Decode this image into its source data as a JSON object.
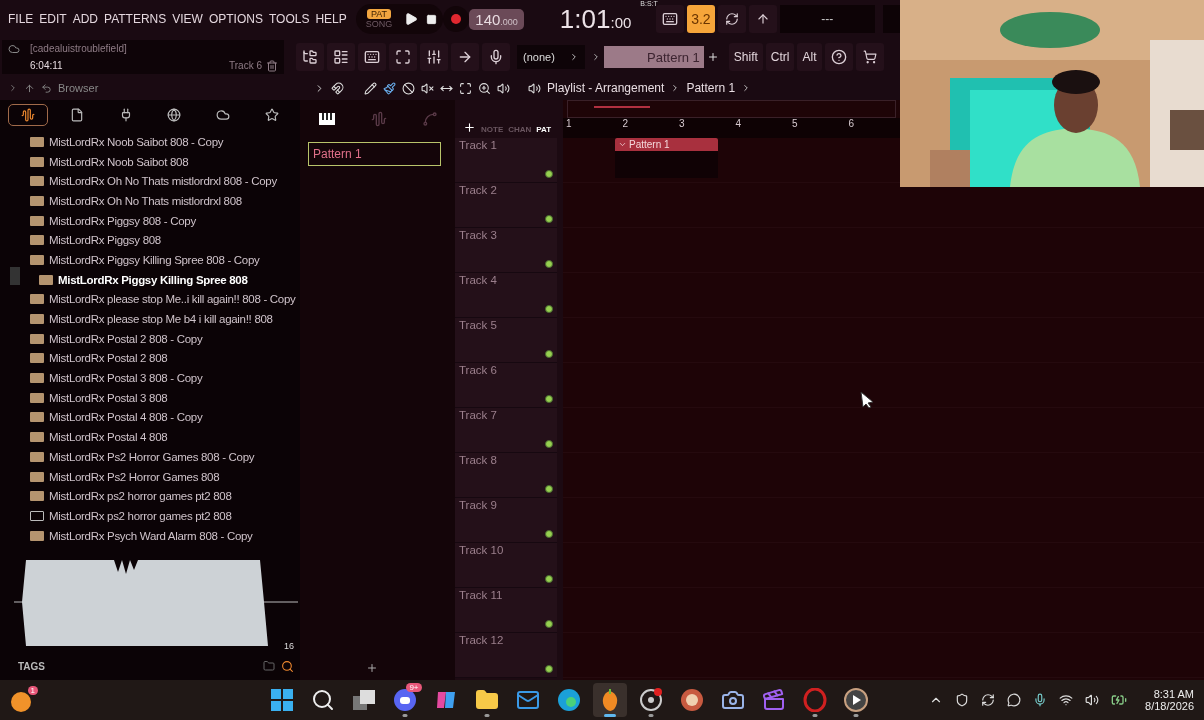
{
  "menu": [
    "FILE",
    "EDIT",
    "ADD",
    "PATTERNS",
    "VIEW",
    "OPTIONS",
    "TOOLS",
    "HELP"
  ],
  "transport": {
    "modes": [
      {
        "label": "PAT",
        "selected": true
      },
      {
        "label": "SONG",
        "selected": false
      }
    ],
    "tempo": "140",
    "tempo_fraction": ".000"
  },
  "time": {
    "main": "1:01",
    "sub": ":00",
    "format": "B:S:T"
  },
  "displays": {
    "value": "3.2",
    "center": "---"
  },
  "hint": {
    "user": "[cadealuistroublefield]",
    "elapsed": "6:04:11",
    "track": "Track 6"
  },
  "pattern_selector": {
    "channel": "(none)",
    "pattern": "Pattern 1"
  },
  "modifier_keys": [
    "Shift",
    "Ctrl",
    "Alt"
  ],
  "browser": {
    "title": "Browser",
    "tabs": [
      {
        "kind": "all",
        "selected": true
      },
      {
        "kind": "files",
        "selected": false
      },
      {
        "kind": "plugins",
        "selected": false
      },
      {
        "kind": "web",
        "selected": false
      },
      {
        "kind": "cloud",
        "selected": false
      },
      {
        "kind": "favorites",
        "selected": false
      }
    ],
    "files": [
      {
        "name": "MistLordRx Noob Saibot 808 - Copy",
        "kind": "mp3",
        "selected": false
      },
      {
        "name": "MistLordRx Noob Saibot 808",
        "kind": "mp3",
        "selected": false
      },
      {
        "name": "MistLordRx Oh No Thats mistlordrxl 808 - Copy",
        "kind": "mp3",
        "selected": false
      },
      {
        "name": "MistLordRx Oh No Thats mistlordrxl 808",
        "kind": "mp3",
        "selected": false
      },
      {
        "name": "MistLordRx Piggsy 808 - Copy",
        "kind": "mp3",
        "selected": false
      },
      {
        "name": "MistLordRx Piggsy 808",
        "kind": "mp3",
        "selected": false
      },
      {
        "name": "MistLordRx Piggsy Killing Spree 808 - Copy",
        "kind": "mp3",
        "selected": false
      },
      {
        "name": "MistLordRx Piggsy Killing Spree 808",
        "kind": "mp3",
        "selected": true
      },
      {
        "name": "MistLordRx please stop Me..i kill again!! 808 - Copy",
        "kind": "mp3",
        "selected": false
      },
      {
        "name": "MistLordRx please stop Me b4 i kill again!! 808",
        "kind": "mp3",
        "selected": false
      },
      {
        "name": "MistLordRx Postal 2 808 - Copy",
        "kind": "mp3",
        "selected": false
      },
      {
        "name": "MistLordRx Postal 2 808",
        "kind": "mp3",
        "selected": false
      },
      {
        "name": "MistLordRx Postal 3 808 - Copy",
        "kind": "mp3",
        "selected": false
      },
      {
        "name": "MistLordRx Postal 3 808",
        "kind": "mp3",
        "selected": false
      },
      {
        "name": "MistLordRx Postal 4 808 - Copy",
        "kind": "mp3",
        "selected": false
      },
      {
        "name": "MistLordRx Postal 4 808",
        "kind": "mp3",
        "selected": false
      },
      {
        "name": "MistLordRx Ps2 Horror Games 808 - Copy",
        "kind": "mp3",
        "selected": false
      },
      {
        "name": "MistLordRx Ps2 Horror Games 808",
        "kind": "mp3",
        "selected": false
      },
      {
        "name": "MistLordRx ps2 horror games pt2 808",
        "kind": "mp3",
        "selected": false
      },
      {
        "name": "MistLordRx ps2 horror games pt2 808",
        "kind": "file",
        "selected": false
      },
      {
        "name": "MistLordRx Psych Ward Alarm 808 - Copy",
        "kind": "mp3",
        "selected": false
      }
    ],
    "preview": {
      "length": "16"
    },
    "tags_label": "TAGS"
  },
  "playlist": {
    "breadcrumb": [
      "Playlist - Arrangement",
      "Pattern 1"
    ],
    "picker_tabs": [
      {
        "kind": "piano",
        "selected": true
      },
      {
        "kind": "audio",
        "selected": false
      },
      {
        "kind": "automation",
        "selected": false
      }
    ],
    "patterns": [
      {
        "name": "Pattern 1",
        "selected": true
      }
    ],
    "view_modes": [
      {
        "label": "NOTE",
        "selected": false
      },
      {
        "label": "CHAN",
        "selected": false
      },
      {
        "label": "PAT",
        "selected": true
      }
    ],
    "bars": [
      "1",
      "2",
      "3",
      "4",
      "5",
      "6"
    ],
    "tracks": [
      {
        "name": "Track 1",
        "clips": [
          {
            "name": "Pattern 1"
          }
        ]
      },
      {
        "name": "Track 2"
      },
      {
        "name": "Track 3"
      },
      {
        "name": "Track 4"
      },
      {
        "name": "Track 5"
      },
      {
        "name": "Track 6"
      },
      {
        "name": "Track 7"
      },
      {
        "name": "Track 8"
      },
      {
        "name": "Track 9"
      },
      {
        "name": "Track 10"
      },
      {
        "name": "Track 11"
      },
      {
        "name": "Track 12"
      }
    ]
  },
  "taskbar": {
    "widget_badge": "1",
    "apps": [
      {
        "kind": "start",
        "running": false,
        "selected": false
      },
      {
        "kind": "search",
        "running": false,
        "selected": false
      },
      {
        "kind": "taskview",
        "running": false,
        "selected": false
      },
      {
        "kind": "chat",
        "badge": "9+",
        "running": true,
        "selected": false
      },
      {
        "kind": "assistant",
        "running": false,
        "selected": false
      },
      {
        "kind": "folder",
        "running": true,
        "selected": false
      },
      {
        "kind": "mail",
        "running": false,
        "selected": false
      },
      {
        "kind": "browser",
        "running": false,
        "selected": false
      },
      {
        "kind": "fruit",
        "running": true,
        "selected": true
      },
      {
        "kind": "recorder",
        "running": true,
        "selected": false
      },
      {
        "kind": "badge",
        "running": false,
        "selected": false
      },
      {
        "kind": "camera",
        "running": false,
        "selected": false
      },
      {
        "kind": "clapper",
        "running": false,
        "selected": false
      },
      {
        "kind": "opera",
        "running": true,
        "selected": false
      },
      {
        "kind": "player",
        "running": true,
        "selected": false
      }
    ],
    "time": "8:31 AM",
    "date": "8/18/2026"
  }
}
